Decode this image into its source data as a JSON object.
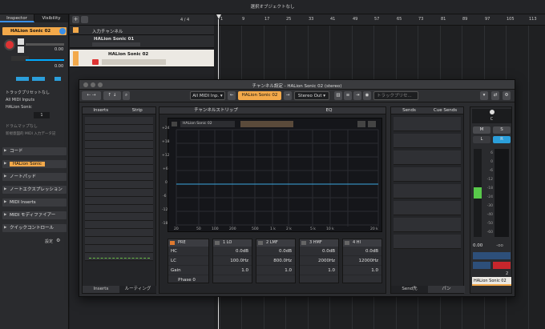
{
  "status_text": "選択オブジェクトなし",
  "inspector": {
    "tabs": [
      "Inspector",
      "Visibility"
    ],
    "track_name": "HALion Sonic 02",
    "volume_value": "0.00",
    "pan_value": "0.00",
    "routing": [
      "トラックプリセットなし",
      "All MIDI Inputs",
      "HALion Sonic"
    ],
    "channel": "1",
    "drum_map": "ドラムマップなし",
    "midi_input_info": "新規意図的 MIDI 入力データ記",
    "sections": [
      "コード",
      "HALion Sonic",
      "ノートパッド",
      "ノートエクスプレッション",
      "MIDI Inserts",
      "MIDI モディファイアー",
      "クイックコントロール"
    ],
    "settings_label": "設定"
  },
  "arrange": {
    "counter": "4 / 4",
    "tracks": [
      "入力チャンネル",
      "HALion Sonic 01",
      "HALion Sonic 02"
    ],
    "ruler": [
      "1",
      "9",
      "17",
      "25",
      "33",
      "41",
      "49",
      "57",
      "65",
      "73",
      "81",
      "89",
      "97",
      "105",
      "113"
    ]
  },
  "window": {
    "title": "チャンネル設定 - HALion Sonic 02 (stereo)",
    "input": "All MIDI Inp.",
    "channel": "HALion Sonic 02",
    "output": "Stereo Out",
    "preset": "トラックプリセ...",
    "inserts_tab": "Inserts",
    "strip_tab": "Strip",
    "strip_title": "チャンネルストリップ",
    "eq_title": "EQ",
    "sends_tab": "Sends",
    "cue_tab": "Cue Sends",
    "eq_preset": "HALion Sonic 02",
    "db_labels": [
      "+24",
      "+18",
      "+12",
      "+6",
      "0",
      "-6",
      "-12",
      "-18",
      "-24"
    ],
    "freq_labels": [
      "20",
      "50",
      "100",
      "200",
      "500",
      "1 k",
      "2 k",
      "5 k",
      "10 k",
      "20 k"
    ],
    "pre": {
      "title": "PRE",
      "hc": "HC",
      "lc": "LC",
      "gain": "Gain",
      "phase": "Phase 0"
    },
    "bands": [
      {
        "name": "1 LO",
        "gain": "0.0dB",
        "freq": "100.0Hz",
        "q": "1.0"
      },
      {
        "name": "2 LMF",
        "gain": "0.0dB",
        "freq": "800.0Hz",
        "q": "1.0"
      },
      {
        "name": "3 HMF",
        "gain": "0.0dB",
        "freq": "2000Hz",
        "q": "1.0"
      },
      {
        "name": "4 HI",
        "gain": "0.0dB",
        "freq": "12000Hz",
        "q": "1.0"
      }
    ],
    "bottom_left": [
      "Inserts",
      "ルーティング"
    ],
    "bottom_right": [
      "Send先",
      "パン"
    ],
    "fader": {
      "pan": "C",
      "m": "M",
      "s": "S",
      "value": "0.00",
      "peak": "-oo",
      "name": "HALion Sonic 02",
      "num": "2",
      "scale": [
        "6",
        "0",
        "-6",
        "-12",
        "-18",
        "-24",
        "-30",
        "-40",
        "-50",
        "-60"
      ]
    }
  }
}
